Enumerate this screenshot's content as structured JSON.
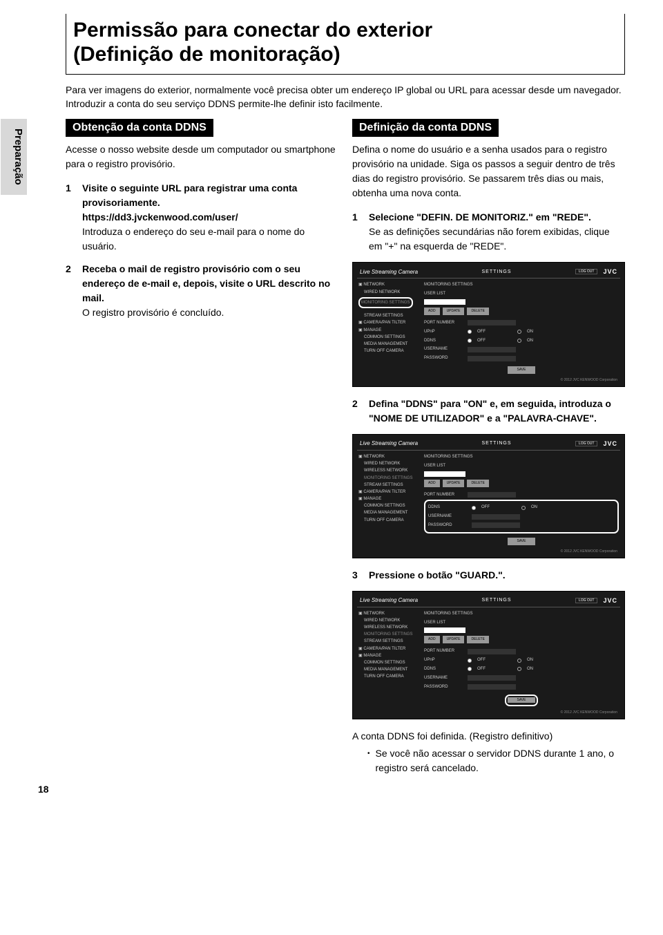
{
  "title_line1": "Permissão para conectar do exterior",
  "title_line2": "(Definição de monitoração)",
  "intro": "Para ver imagens do exterior, normalmente você precisa obter um endereço IP global ou URL para acessar desde um navegador. Introduzir a conta do seu serviço DDNS permite-lhe definir isto facilmente.",
  "sidetab": "Preparação",
  "left": {
    "heading": "Obtenção da conta DDNS",
    "para": "Acesse o nosso website desde um computador ou smartphone para o registro provisório.",
    "step1_bold": "Visite o seguinte URL para registrar uma conta provisoriamente.",
    "step1_url": "https://dd3.jvckenwood.com/user/",
    "step1_plain": "Introduza o endereço do seu e-mail para o nome do usuário.",
    "step2_bold": "Receba o mail de registro provisório com o seu endereço de e-mail e, depois, visite o URL descrito no mail.",
    "step2_plain": "O registro provisório é concluído."
  },
  "right": {
    "heading": "Definição da conta DDNS",
    "para": "Defina o nome do usuário e a senha usados para o registro provisório na unidade. Siga os passos a seguir dentro de três dias do registro provisório. Se passarem três dias ou mais, obtenha uma nova conta.",
    "step1_bold": "Selecione \"DEFIN. DE MONITORIZ.\" em \"REDE\".",
    "step1_plain": "Se as definições secundárias não forem exibidas, clique em \"+\" na esquerda de \"REDE\".",
    "step2_bold": "Defina \"DDNS\" para \"ON\" e, em seguida, introduza o \"NOME DE UTILIZADOR\" e a \"PALAVRA-CHAVE\".",
    "step3_bold": "Pressione o botão \"GUARD.\".",
    "final_line": "A conta DDNS foi definida. (Registro definitivo)",
    "bullet": "Se você não acessar o servidor DDNS durante 1 ano, o registro será cancelado."
  },
  "screenshot": {
    "product": "Live Streaming Camera",
    "settings": "SETTINGS",
    "logout": "LOG OUT",
    "jvc": "JVC",
    "nav": [
      "NETWORK",
      "WIRED NETWORK",
      "WIRELESS NETWORK",
      "MONITORING SETTINGS",
      "STREAM SETTINGS",
      "CAMERA/PAN TILTER",
      "MANAGE",
      "COMMON SETTINGS",
      "MEDIA MANAGEMENT",
      "TURN OFF CAMERA"
    ],
    "monitoring": "MONITORING SETTINGS",
    "userlist": "USER LIST",
    "add": "ADD",
    "update": "UPDATE",
    "delete": "DELETE",
    "portnumber": "PORT NUMBER",
    "upnp": "UPnP",
    "ddns": "DDNS",
    "username": "USERNAME",
    "password": "PASSWORD",
    "off": "OFF",
    "on": "ON",
    "save": "SAVE",
    "copyright": "© 2012 JVC KENWOOD Corporation"
  },
  "pagenum": "18"
}
